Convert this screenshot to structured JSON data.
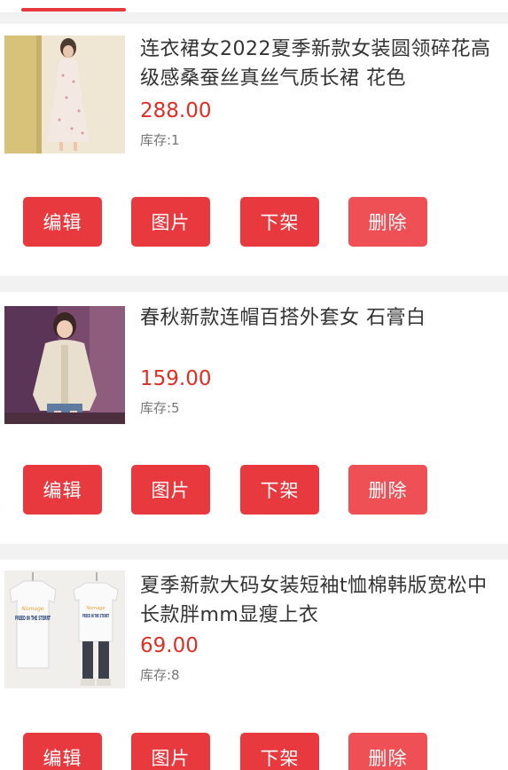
{
  "colors": {
    "accent": "#e8393f",
    "delete": "#ee5055",
    "price": "#e02e24"
  },
  "products": [
    {
      "title": "连衣裙女2022夏季新款女装圆领碎花高级感桑蚕丝真丝气质长裙 花色",
      "price": "288.00",
      "stock": "库存:1",
      "image_icon": "dress-photo"
    },
    {
      "title": "春秋新款连帽百搭外套女 石膏白",
      "price": "159.00",
      "stock": "库存:5",
      "image_icon": "jacket-photo"
    },
    {
      "title": "夏季新款大码女装短袖t恤棉韩版宽松中长款胖mm显瘦上衣",
      "price": "69.00",
      "stock": "库存:8",
      "image_icon": "tshirt-photo",
      "print_text": "FREED IN THE STERRT"
    }
  ],
  "actions": {
    "edit": "编辑",
    "images": "图片",
    "delist": "下架",
    "delete": "删除"
  }
}
